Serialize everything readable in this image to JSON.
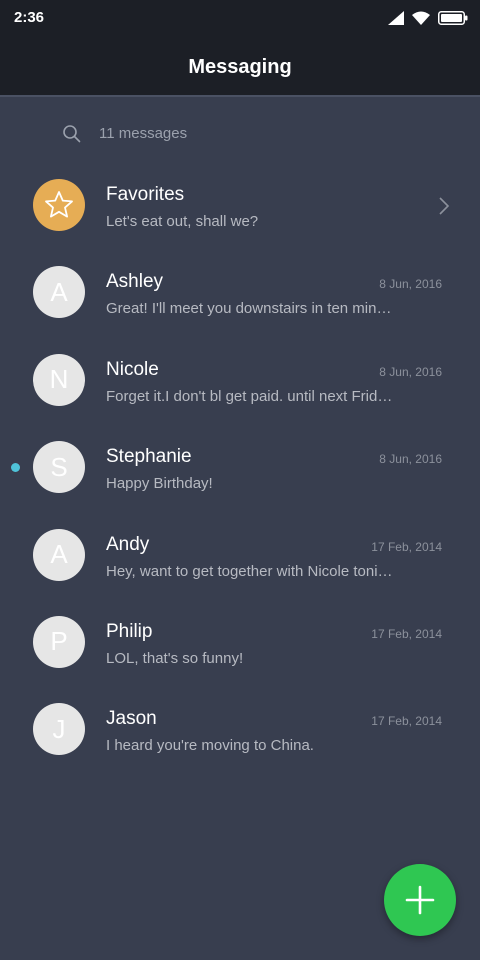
{
  "status_bar": {
    "time": "2:36",
    "icons": [
      "signal-icon",
      "wifi-icon",
      "battery-icon"
    ]
  },
  "header": {
    "title": "Messaging"
  },
  "search": {
    "icon": "search-icon",
    "label": "11 messages"
  },
  "conversations": [
    {
      "name": "Favorites",
      "preview": "Let's eat out, shall we?",
      "date": "",
      "avatar": "star-icon",
      "type": "favorites",
      "unread": false
    },
    {
      "name": "Ashley",
      "preview": "Great! I'll meet you downstairs in ten minutes.",
      "date": "8 Jun, 2016",
      "avatar": "A",
      "unread": false
    },
    {
      "name": "Nicole",
      "preview": "Forget it.I don't bl get paid. until next Friday.",
      "date": "8 Jun, 2016",
      "avatar": "N",
      "unread": false
    },
    {
      "name": "Stephanie",
      "preview": "Happy Birthday!",
      "date": "8 Jun, 2016",
      "avatar": "S",
      "unread": true
    },
    {
      "name": "Andy",
      "preview": "Hey, want to get together with Nicole tonight?",
      "date": "17 Feb, 2014",
      "avatar": "A",
      "unread": false
    },
    {
      "name": "Philip",
      "preview": "LOL, that's so funny!",
      "date": "17 Feb, 2014",
      "avatar": "P",
      "unread": false
    },
    {
      "name": "Jason",
      "preview": "I heard you're moving to China.",
      "date": "17 Feb, 2014",
      "avatar": "J",
      "unread": false
    }
  ],
  "fab": {
    "icon": "plus-icon"
  },
  "colors": {
    "background": "#383e4f",
    "topbar": "#1c1f26",
    "favorites_avatar": "#e6ad55",
    "contact_avatar": "#e6e6e6",
    "fab": "#2fc752",
    "unread_dot": "#4fc3d9"
  }
}
